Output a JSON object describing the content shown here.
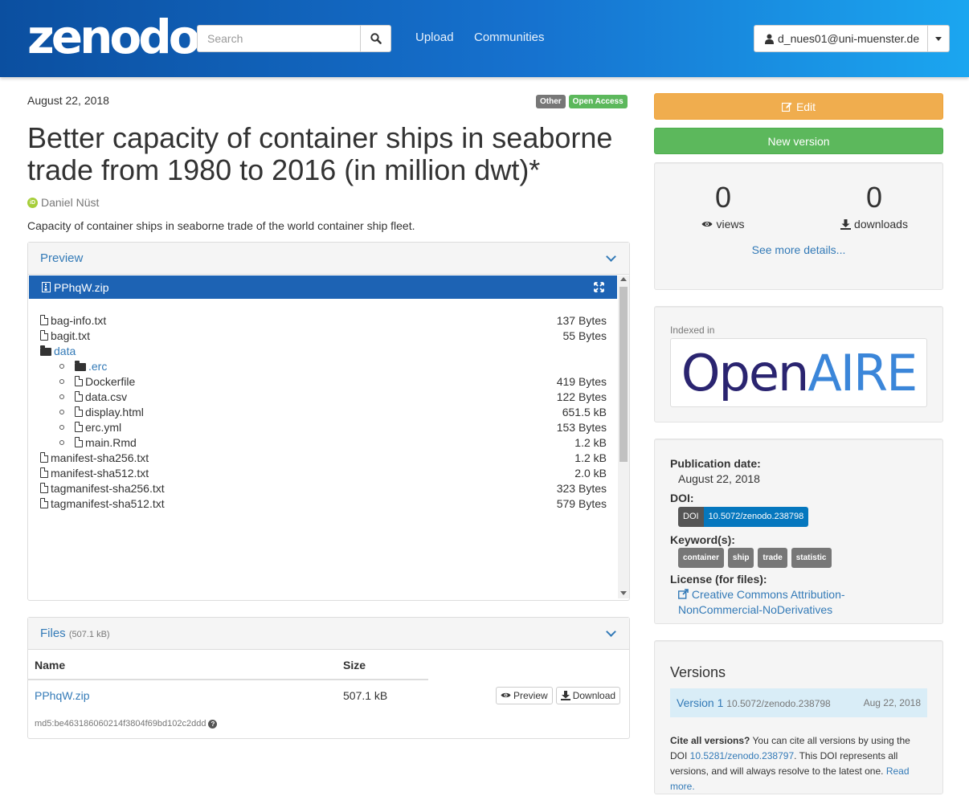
{
  "header": {
    "logo": "zenodo",
    "search_placeholder": "Search",
    "nav_upload": "Upload",
    "nav_communities": "Communities",
    "user_email": "d_nues01@uni-muenster.de"
  },
  "record": {
    "publication_date": "August 22, 2018",
    "badges": [
      "Other",
      "Open Access"
    ],
    "title": "Better capacity of container ships in seaborne trade from 1980 to 2016 (in million dwt)*",
    "creator": "Daniel Nüst",
    "description": "Capacity of container ships in seaborne trade of the world container ship fleet."
  },
  "preview": {
    "heading": "Preview",
    "zip_name": "PPhqW.zip",
    "tree": [
      {
        "name": "bag-info.txt",
        "size": "137 Bytes"
      },
      {
        "name": "bagit.txt",
        "size": "55 Bytes"
      },
      {
        "name": "data",
        "size": ""
      },
      {
        "name": ".erc",
        "size": ""
      },
      {
        "name": "Dockerfile",
        "size": "419 Bytes"
      },
      {
        "name": "data.csv",
        "size": "122 Bytes"
      },
      {
        "name": "display.html",
        "size": "651.5 kB"
      },
      {
        "name": "erc.yml",
        "size": "153 Bytes"
      },
      {
        "name": "main.Rmd",
        "size": "1.2 kB"
      },
      {
        "name": "manifest-sha256.txt",
        "size": "1.2 kB"
      },
      {
        "name": "manifest-sha512.txt",
        "size": "2.0 kB"
      },
      {
        "name": "tagmanifest-sha256.txt",
        "size": "323 Bytes"
      },
      {
        "name": "tagmanifest-sha512.txt",
        "size": "579 Bytes"
      }
    ]
  },
  "files": {
    "heading": "Files",
    "total_size": "(507.1 kB)",
    "col_name": "Name",
    "col_size": "Size",
    "file_name": "PPhqW.zip",
    "file_size": "507.1 kB",
    "preview_btn": "Preview",
    "download_btn": "Download",
    "md5": "md5:be463186060214f3804f69bd102c2ddd"
  },
  "sidebar": {
    "edit_btn": "Edit",
    "new_version_btn": "New version",
    "views_count": "0",
    "views_label": "views",
    "downloads_count": "0",
    "downloads_label": "downloads",
    "see_more": "See more details...",
    "indexed_in": "Indexed in",
    "openaire_open": "Open",
    "openaire_aire": "AIRE",
    "publication_date_label": "Publication date:",
    "publication_date": "August 22, 2018",
    "doi_label": "DOI:",
    "doi_prefix": "DOI",
    "doi_value": "10.5072/zenodo.238798",
    "keywords_label": "Keyword(s):",
    "keywords": [
      "container",
      "ship",
      "trade",
      "statistic"
    ],
    "license_label": "License (for files):",
    "license_line1": "Creative Commons Attribution-",
    "license_line2": "NonCommercial-NoDerivatives",
    "versions_title": "Versions",
    "version_name": "Version 1",
    "version_doi": "10.5072/zenodo.238798",
    "version_date": "Aug 22, 2018",
    "cite_bold": "Cite all versions?",
    "cite_text1": " You can cite all versions by using the DOI ",
    "cite_doi": "10.5281/zenodo.238797",
    "cite_text2": ". This DOI represents all versions, and will always resolve to the latest one. ",
    "cite_read_more": "Read more."
  },
  "colors": {
    "header_start": "#0b4fa0",
    "header_end": "#1ba6f0",
    "edit": "#f0ad4e",
    "new_version": "#5cb85c",
    "zip_bar": "#1d63b4",
    "doi_badge": "#0577be"
  }
}
